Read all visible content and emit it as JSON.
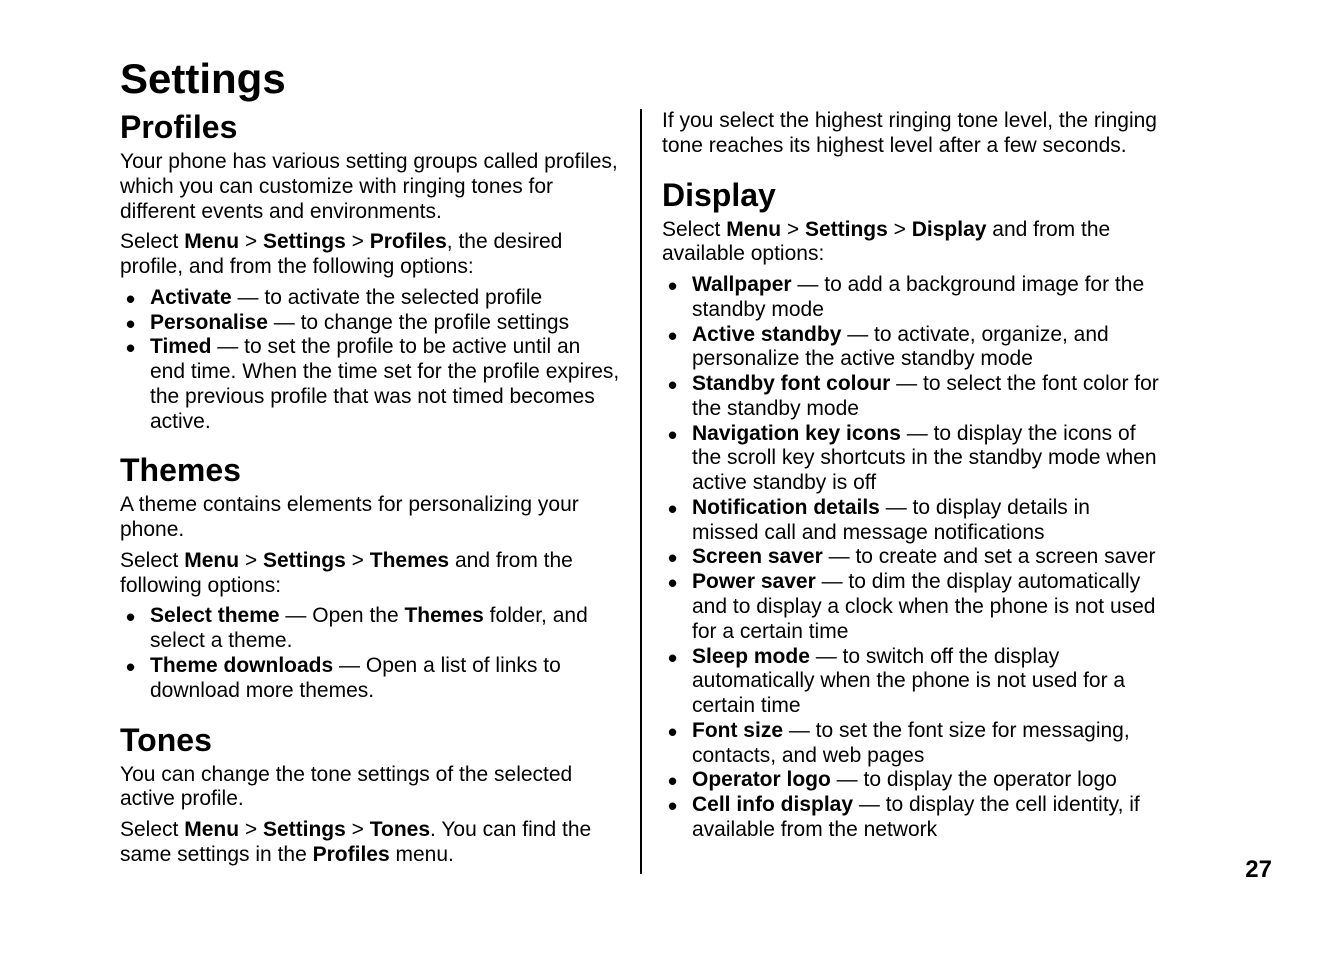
{
  "page_number": "27",
  "h1": "Settings",
  "left": {
    "profiles": {
      "heading": "Profiles",
      "intro": "Your phone has various setting groups called profiles, which you can customize with ringing tones for different events and environments.",
      "select_prefix": "Select ",
      "menu": "Menu",
      "gt1": " > ",
      "settings": "Settings",
      "gt2": " > ",
      "target": "Profiles",
      "select_suffix": ", the desired profile, and from the following options:",
      "items": [
        {
          "term": "Activate",
          "desc": "  — to activate the selected profile"
        },
        {
          "term": "Personalise",
          "desc": "  — to change the profile settings"
        },
        {
          "term": "Timed",
          "desc": "  — to set the profile to be active until an end time. When the time set for the profile expires, the previous profile that was not timed becomes active."
        }
      ]
    },
    "themes": {
      "heading": "Themes",
      "intro": "A theme contains elements for personalizing your phone.",
      "select_prefix": "Select ",
      "menu": "Menu",
      "gt1": " > ",
      "settings": "Settings",
      "gt2": " > ",
      "target": "Themes",
      "select_suffix": " and from the following options:",
      "items": [
        {
          "term": "Select theme",
          "mid": " — Open the ",
          "b2": "Themes",
          "desc": " folder, and select a theme."
        },
        {
          "term": "Theme downloads",
          "desc": "  — Open a list of links to download more themes."
        }
      ]
    },
    "tones": {
      "heading": "Tones",
      "intro": "You can change the tone settings of the selected active profile.",
      "select_prefix": "Select ",
      "menu": "Menu",
      "gt1": " > ",
      "settings": "Settings",
      "gt2": " > ",
      "target": "Tones",
      "mid1": ". You can find the same settings in the ",
      "b2": "Profiles",
      "suffix": " menu."
    }
  },
  "right": {
    "tones_note": "If you select the highest ringing tone level, the ringing tone reaches its highest level after a few seconds.",
    "display": {
      "heading": "Display",
      "select_prefix": "Select ",
      "menu": "Menu",
      "gt1": " > ",
      "settings": "Settings",
      "gt2": " > ",
      "target": "Display",
      "select_suffix": " and from the available options:",
      "items": [
        {
          "term": "Wallpaper",
          "desc": "  — to add a background image for the standby mode"
        },
        {
          "term": "Active standby",
          "desc": "  — to activate, organize, and personalize the active standby mode"
        },
        {
          "term": "Standby font colour",
          "desc": "  — to select the font color for the standby mode"
        },
        {
          "term": "Navigation key icons",
          "desc": "  — to display the icons of the scroll key shortcuts in the standby mode when active standby is off"
        },
        {
          "term": "Notification details",
          "desc": "  — to display details in missed call and message notifications"
        },
        {
          "term": "Screen saver",
          "desc": "  — to create and set a screen saver"
        },
        {
          "term": "Power saver",
          "desc": "  — to dim the display automatically and to display a clock when the phone is not used for a certain time"
        },
        {
          "term": "Sleep mode",
          "desc": "  — to switch off the display automatically when the phone is not used for a certain time"
        },
        {
          "term": "Font size",
          "desc": "  — to set the font size for messaging, contacts, and web pages"
        },
        {
          "term": "Operator logo",
          "desc": "  — to display the operator logo"
        },
        {
          "term": "Cell info display",
          "desc": "  — to display the cell identity, if available from the network"
        }
      ]
    }
  }
}
